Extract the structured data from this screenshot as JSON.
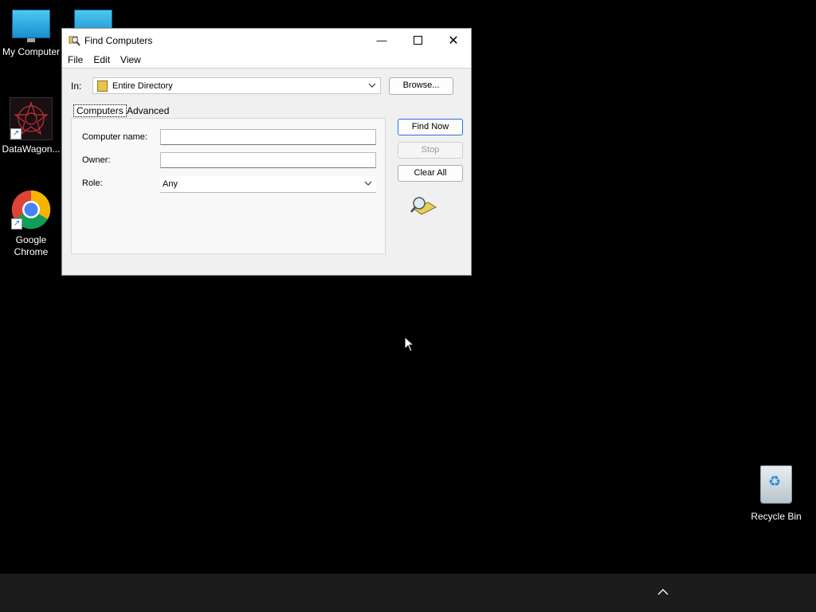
{
  "desktop": {
    "icons": [
      {
        "label": "My Computer"
      },
      {
        "label": ""
      },
      {
        "label": "DataWagon..."
      },
      {
        "label": "Google Chrome"
      },
      {
        "label": "Recycle Bin"
      }
    ]
  },
  "window": {
    "title": "Find Computers",
    "menu": [
      "File",
      "Edit",
      "View"
    ],
    "in_label": "In:",
    "in_value": "Entire Directory",
    "browse_label": "Browse...",
    "tabs": [
      "Computers",
      "Advanced"
    ],
    "fields": {
      "computer_name_label": "Computer name:",
      "computer_name_value": "",
      "owner_label": "Owner:",
      "owner_value": "",
      "role_label": "Role:",
      "role_value": "Any"
    },
    "buttons": {
      "find_now": "Find Now",
      "stop": "Stop",
      "clear_all": "Clear All"
    }
  },
  "taskbar": {
    "tray_chevron": "chevron-up-icon"
  }
}
